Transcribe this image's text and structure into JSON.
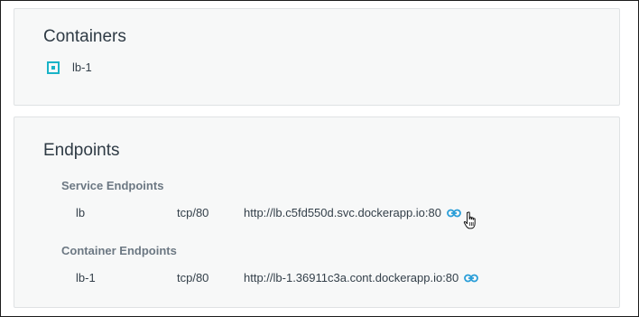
{
  "containers_panel": {
    "title": "Containers",
    "items": [
      {
        "name": "lb-1",
        "icon": "container-icon"
      }
    ]
  },
  "endpoints_panel": {
    "title": "Endpoints",
    "service_endpoints": {
      "label": "Service Endpoints",
      "rows": [
        {
          "name": "lb",
          "protocol": "tcp/80",
          "url": "http://lb.c5fd550d.svc.dockerapp.io:80",
          "icon": "link-icon"
        }
      ]
    },
    "container_endpoints": {
      "label": "Container Endpoints",
      "rows": [
        {
          "name": "lb-1",
          "protocol": "tcp/80",
          "url": "http://lb-1.36911c3a.cont.dockerapp.io:80",
          "icon": "link-icon"
        }
      ]
    }
  },
  "colors": {
    "accent": "#19b3c7",
    "link_icon": "#2a9ed8",
    "panel_bg": "#f7f8f8",
    "text": "#34404a",
    "muted": "#6c7883"
  }
}
